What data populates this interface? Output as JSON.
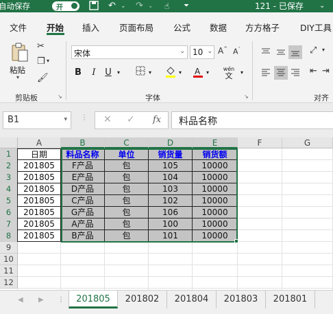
{
  "titlebar": {
    "autosave_label": "自动保存",
    "toggle_label": "开",
    "title": "121 - 已保存",
    "chevron": "⌄"
  },
  "tabs": [
    {
      "label": "文件"
    },
    {
      "label": "开始"
    },
    {
      "label": "插入"
    },
    {
      "label": "页面布局"
    },
    {
      "label": "公式"
    },
    {
      "label": "数据"
    },
    {
      "label": "方方格子"
    },
    {
      "label": "DIY工具"
    }
  ],
  "ribbon": {
    "clipboard": {
      "paste_label": "粘贴",
      "group_label": "剪贴板"
    },
    "font": {
      "font_name": "宋体",
      "font_size": "10",
      "group_label": "字体",
      "bold": "B",
      "italic": "I",
      "underline": "U",
      "wen": "wén"
    },
    "alignment": {
      "group_label": "对齐方"
    }
  },
  "formula_bar": {
    "name_box": "B1",
    "fx": "fx",
    "content": "料品名称"
  },
  "sheet": {
    "columns": [
      "A",
      "B",
      "C",
      "D",
      "E",
      "F",
      "G"
    ],
    "rows": [
      "1",
      "2",
      "3",
      "4",
      "5",
      "6",
      "7",
      "8",
      "9",
      "10",
      "11",
      "12"
    ],
    "headers": [
      "日期",
      "料品名称",
      "单位",
      "销货量",
      "销货额"
    ],
    "data": [
      [
        "201805",
        "F产品",
        "包",
        "105",
        "10000"
      ],
      [
        "201805",
        "E产品",
        "包",
        "104",
        "10000"
      ],
      [
        "201805",
        "D产品",
        "包",
        "103",
        "10000"
      ],
      [
        "201805",
        "C产品",
        "包",
        "102",
        "10000"
      ],
      [
        "201805",
        "G产品",
        "包",
        "106",
        "10000"
      ],
      [
        "201805",
        "A产品",
        "包",
        "100",
        "10000"
      ],
      [
        "201805",
        "B产品",
        "包",
        "101",
        "10000"
      ]
    ]
  },
  "sheet_tabs": [
    "201805",
    "201802",
    "201804",
    "201803",
    "201801"
  ],
  "colors": {
    "accent": "#217346",
    "header_text": "#0000ee",
    "selection_fill": "#c4c4c4"
  }
}
